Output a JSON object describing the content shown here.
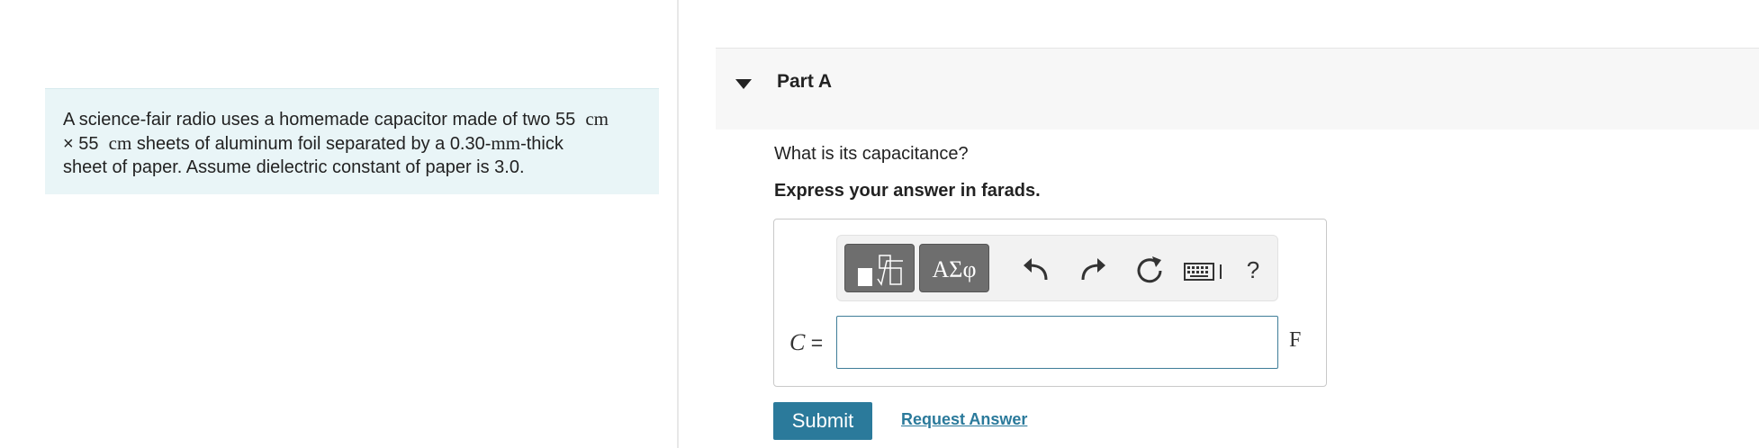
{
  "problem": {
    "text_part1": "A science-fair radio uses a homemade capacitor made of two 55",
    "unit_cm_1": "cm",
    "times_symbol": "×",
    "number_55": "55",
    "unit_cm_2": "cm",
    "text_part2": "sheets of aluminum foil separated by a 0.30-",
    "unit_mm": "mm",
    "text_part3": "-thick",
    "text_line3": "sheet of paper. Assume dielectric constant of paper is 3.0."
  },
  "part": {
    "title": "Part A",
    "question": "What is its capacitance?",
    "instruction": "Express your answer in farads."
  },
  "toolbar": {
    "symbols_label": "ΑΣφ",
    "undo_icon": "undo-icon",
    "redo_icon": "redo-icon",
    "reset_icon": "reset-icon",
    "keyboard_icon": "keyboard-icon",
    "help_label": "?"
  },
  "answer": {
    "variable": "C",
    "equals": "=",
    "value": "",
    "unit": "F"
  },
  "actions": {
    "submit_label": "Submit",
    "request_label": "Request Answer"
  },
  "colors": {
    "accent": "#2b7a9b",
    "problem_bg": "#e9f5f7",
    "toolbar_button": "#6e6e6e"
  }
}
